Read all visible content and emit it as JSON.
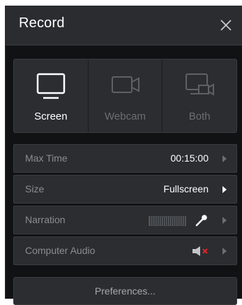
{
  "window": {
    "title": "Record",
    "close_icon": "close-icon"
  },
  "modes": [
    {
      "label": "Screen",
      "icon": "monitor-icon",
      "active": true
    },
    {
      "label": "Webcam",
      "icon": "webcam-icon",
      "active": false
    },
    {
      "label": "Both",
      "icon": "monitor-webcam-icon",
      "active": false
    }
  ],
  "settings": {
    "max_time": {
      "label": "Max Time",
      "value": "00:15:00"
    },
    "size": {
      "label": "Size",
      "value": "Fullscreen"
    },
    "narration": {
      "label": "Narration",
      "icon": "microphone-icon"
    },
    "computer_audio": {
      "label": "Computer Audio",
      "icon": "speaker-muted-icon"
    }
  },
  "preferences": {
    "label": "Preferences..."
  },
  "colors": {
    "background": "#111214",
    "panel": "#2b2d30",
    "muted_x": "#d9262c"
  }
}
